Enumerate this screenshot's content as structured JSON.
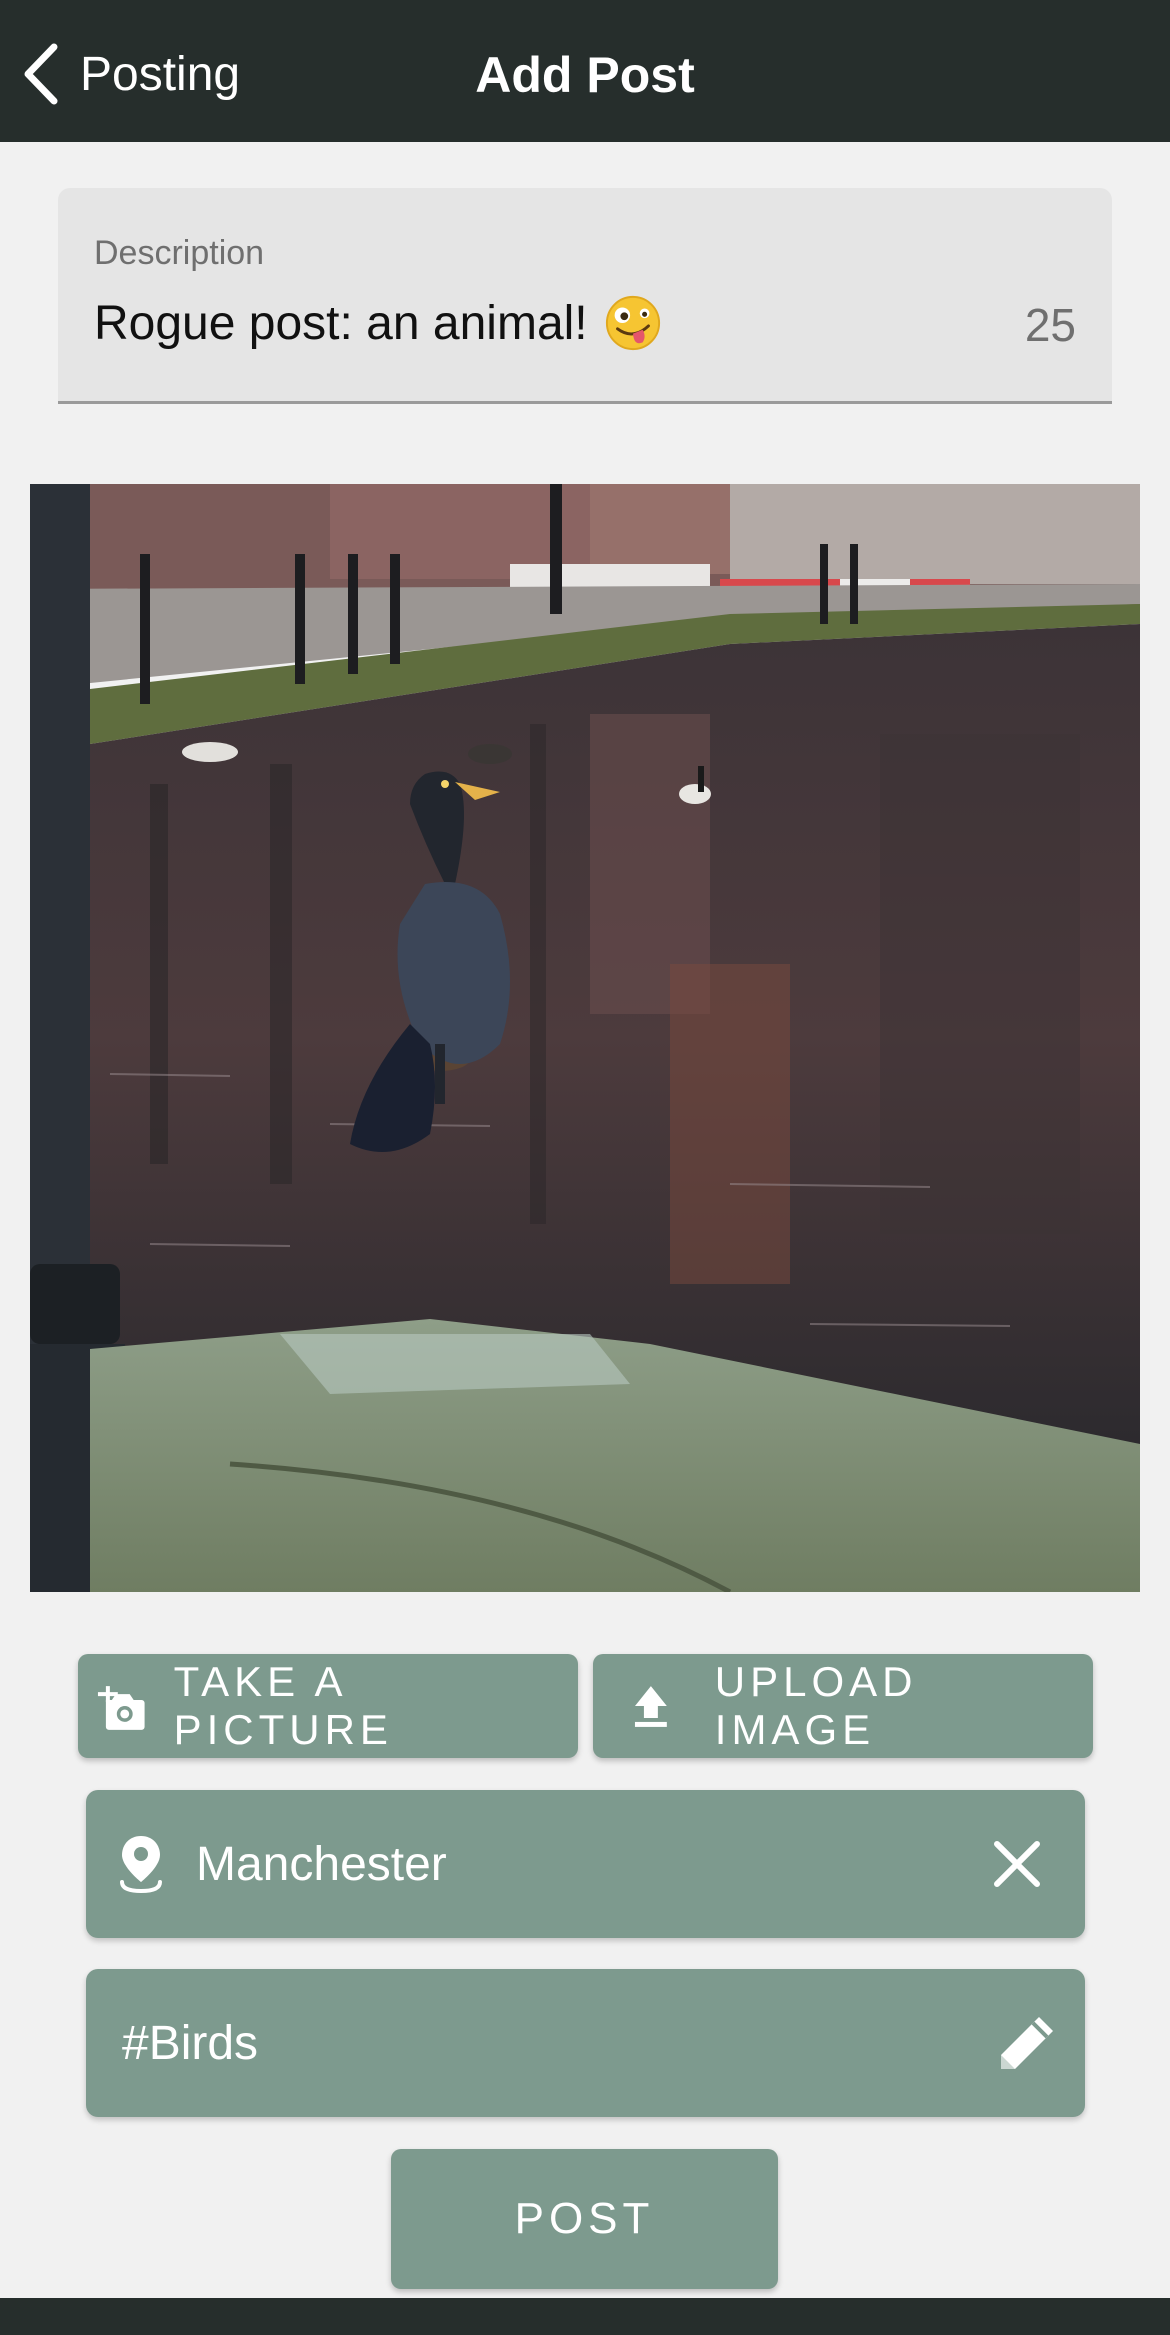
{
  "navbar": {
    "back_label": "Posting",
    "title": "Add Post"
  },
  "description": {
    "label": "Description",
    "value": "Rogue post: an animal!",
    "emoji": "zany-face-emoji",
    "char_count": "25"
  },
  "photo": {
    "subject": "cormorant-on-canal-bank"
  },
  "actions": {
    "take_picture_label": "TAKE A PICTURE",
    "take_picture_icon": "camera-plus-icon",
    "upload_image_label": "UPLOAD IMAGE",
    "upload_image_icon": "upload-icon"
  },
  "location": {
    "value": "Manchester",
    "icon": "location-pin-icon",
    "clear_icon": "close-icon"
  },
  "tags": {
    "value": "#Birds",
    "icon": "pencil-icon"
  },
  "post_button_label": "POST",
  "colors": {
    "navbar_bg": "#262e2c",
    "accent": "#7d9a8e",
    "page_bg": "#f1f1f1",
    "field_bg": "#e5e5e5"
  }
}
